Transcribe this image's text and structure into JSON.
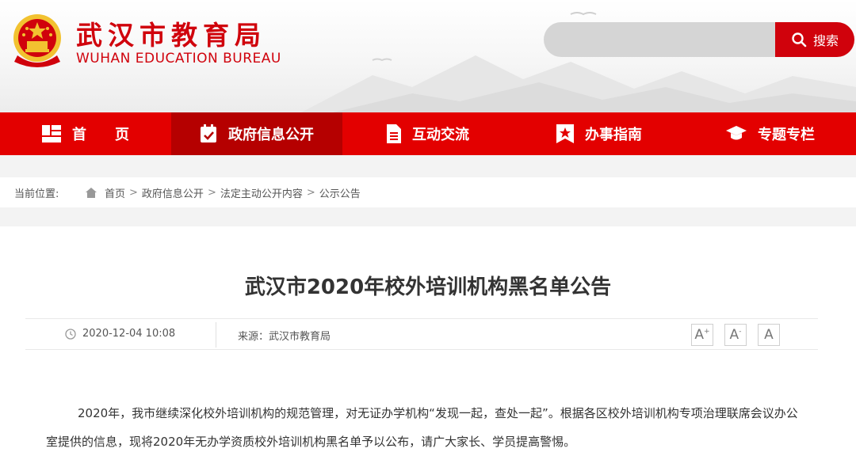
{
  "header": {
    "title_cn": "武汉市教育局",
    "title_en": "WUHAN EDUCATION BUREAU",
    "search": {
      "placeholder": "",
      "button_label": "搜索"
    }
  },
  "nav": [
    {
      "label": "首　　页",
      "icon": "grid-icon"
    },
    {
      "label": "政府信息公开",
      "icon": "calendar-check-icon",
      "active": true
    },
    {
      "label": "互动交流",
      "icon": "document-icon"
    },
    {
      "label": "办事指南",
      "icon": "star-badge-icon"
    },
    {
      "label": "专题专栏",
      "icon": "graduation-cap-icon"
    }
  ],
  "breadcrumb": {
    "label": "当前位置:",
    "items": [
      "首页",
      "政府信息公开",
      "法定主动公开内容",
      "公示公告"
    ],
    "separator": ">"
  },
  "article": {
    "title": "武汉市2020年校外培训机构黑名单公告",
    "date": "2020-12-04 10:08",
    "source": "来源：武汉市教育局",
    "font_controls": [
      "A+",
      "A-",
      "A"
    ],
    "body": "2020年，我市继续深化校外培训机构的规范管理，对无证办学机构“发现一起，查处一起”。根据各区校外培训机构专项治理联席会议办公室提供的信息，现将2020年无办学资质校外培训机构黑名单予以公布，请广大家长、学员提高警惕。"
  },
  "colors": {
    "brand_red": "#d0020c",
    "nav_red": "#e30000",
    "nav_active": "#b50000"
  }
}
